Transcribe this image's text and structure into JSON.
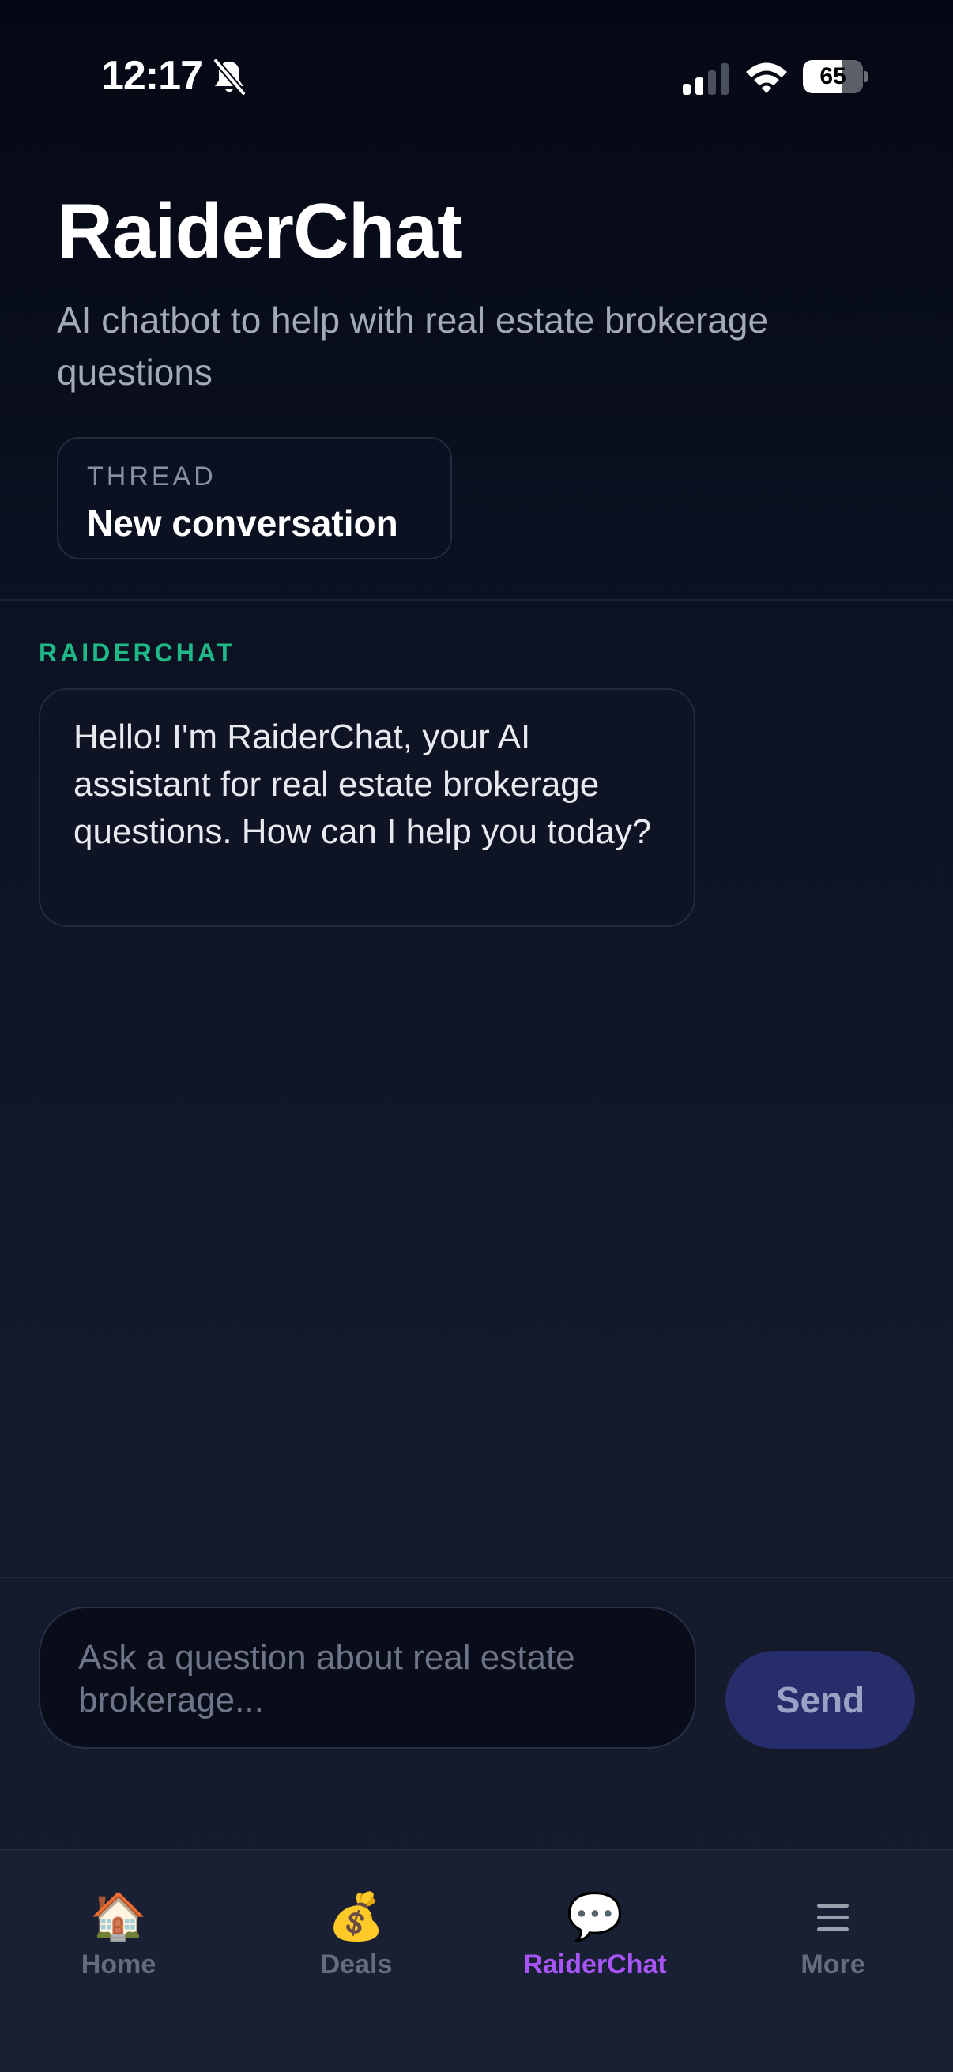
{
  "status_bar": {
    "time": "12:17",
    "battery": "65",
    "icons": [
      "bell-slash-icon",
      "cellular-signal-icon",
      "wifi-icon",
      "battery-icon"
    ]
  },
  "header": {
    "title": "RaiderChat",
    "subtitle": "AI chatbot to help with real estate brokerage questions"
  },
  "thread": {
    "label": "THREAD",
    "value": "New conversation"
  },
  "messages": [
    {
      "sender": "RAIDERCHAT",
      "text": "Hello! I'm RaiderChat, your AI assistant for real estate brokerage questions. How can I help you today?"
    }
  ],
  "composer": {
    "placeholder": "Ask a question about real estate brokerage...",
    "send_label": "Send"
  },
  "tabs": [
    {
      "label": "Home",
      "icon": "house-icon",
      "glyph": "🏠",
      "active": false
    },
    {
      "label": "Deals",
      "icon": "money-bag-icon",
      "glyph": "💰",
      "active": false
    },
    {
      "label": "RaiderChat",
      "icon": "speech-bubble-icon",
      "glyph": "💬",
      "active": true
    },
    {
      "label": "More",
      "icon": "menu-icon",
      "glyph": "",
      "active": false
    }
  ],
  "colors": {
    "background": "#0c1222",
    "accent_green": "#1fb887",
    "active_tab": "#a855f7",
    "send_button": "#272c6a"
  }
}
